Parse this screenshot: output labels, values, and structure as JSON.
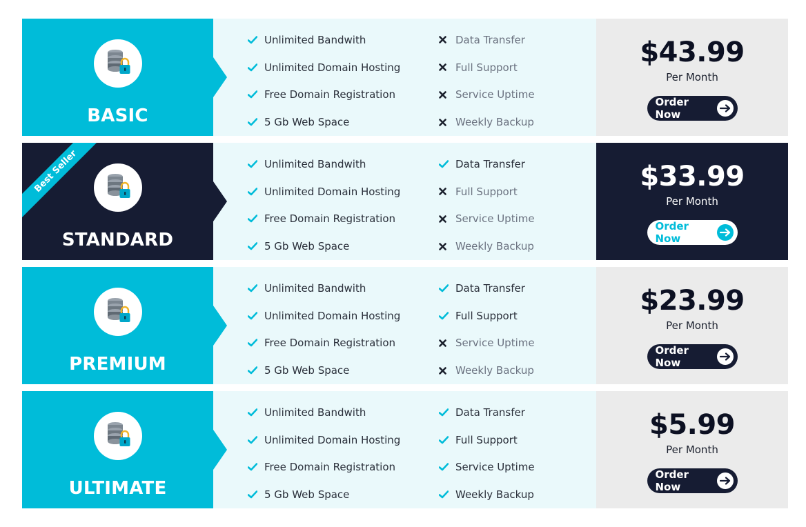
{
  "colors": {
    "accent": "#00bcd9",
    "dark": "#161c33",
    "features_bg": "#eaf9fb",
    "price_bg": "#ebebeb"
  },
  "icons": {
    "plan": "database-lock-icon",
    "included": "check-icon",
    "excluded": "cross-icon",
    "order": "arrow-right-icon"
  },
  "plans": [
    {
      "name": "BASIC",
      "price": "$43.99",
      "period": "Per Month",
      "button": "Order Now",
      "badge": "",
      "features_left": [
        {
          "label": "Unlimited Bandwith",
          "included": true
        },
        {
          "label": "Unlimited Domain Hosting",
          "included": true
        },
        {
          "label": "Free Domain Registration",
          "included": true
        },
        {
          "label": "5 Gb Web Space",
          "included": true
        }
      ],
      "features_right": [
        {
          "label": "Data Transfer",
          "included": false
        },
        {
          "label": "Full Support",
          "included": false
        },
        {
          "label": "Service Uptime",
          "included": false
        },
        {
          "label": "Weekly Backup",
          "included": false
        }
      ]
    },
    {
      "name": "STANDARD",
      "price": "$33.99",
      "period": "Per Month",
      "button": "Order Now",
      "badge": "Best Seller",
      "features_left": [
        {
          "label": "Unlimited Bandwith",
          "included": true
        },
        {
          "label": "Unlimited Domain Hosting",
          "included": true
        },
        {
          "label": "Free Domain Registration",
          "included": true
        },
        {
          "label": "5 Gb Web Space",
          "included": true
        }
      ],
      "features_right": [
        {
          "label": "Data Transfer",
          "included": true
        },
        {
          "label": "Full Support",
          "included": false
        },
        {
          "label": "Service Uptime",
          "included": false
        },
        {
          "label": "Weekly Backup",
          "included": false
        }
      ]
    },
    {
      "name": "PREMIUM",
      "price": "$23.99",
      "period": "Per Month",
      "button": "Order Now",
      "badge": "",
      "features_left": [
        {
          "label": "Unlimited Bandwith",
          "included": true
        },
        {
          "label": "Unlimited Domain Hosting",
          "included": true
        },
        {
          "label": "Free Domain Registration",
          "included": true
        },
        {
          "label": "5 Gb Web Space",
          "included": true
        }
      ],
      "features_right": [
        {
          "label": "Data Transfer",
          "included": true
        },
        {
          "label": "Full Support",
          "included": true
        },
        {
          "label": "Service Uptime",
          "included": false
        },
        {
          "label": "Weekly Backup",
          "included": false
        }
      ]
    },
    {
      "name": "ULTIMATE",
      "price": "$5.99",
      "period": "Per Month",
      "button": "Order Now",
      "badge": "",
      "features_left": [
        {
          "label": "Unlimited Bandwith",
          "included": true
        },
        {
          "label": "Unlimited Domain Hosting",
          "included": true
        },
        {
          "label": "Free Domain Registration",
          "included": true
        },
        {
          "label": "5 Gb Web Space",
          "included": true
        }
      ],
      "features_right": [
        {
          "label": "Data Transfer",
          "included": true
        },
        {
          "label": "Full Support",
          "included": true
        },
        {
          "label": "Service Uptime",
          "included": true
        },
        {
          "label": "Weekly Backup",
          "included": true
        }
      ]
    }
  ]
}
